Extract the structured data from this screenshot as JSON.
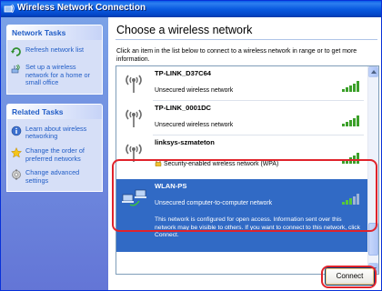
{
  "window": {
    "title": "Wireless Network Connection"
  },
  "sidebar": {
    "groups": [
      {
        "header": "Network Tasks",
        "items": [
          {
            "label": "Refresh network list",
            "icon": "refresh-icon"
          },
          {
            "label": "Set up a wireless network for a home or small office",
            "icon": "setup-network-icon"
          }
        ]
      },
      {
        "header": "Related Tasks",
        "items": [
          {
            "label": "Learn about wireless networking",
            "icon": "info-icon"
          },
          {
            "label": "Change the order of preferred networks",
            "icon": "star-icon"
          },
          {
            "label": "Change advanced settings",
            "icon": "settings-icon"
          }
        ]
      }
    ]
  },
  "main": {
    "title": "Choose a wireless network",
    "instruction": "Click an item in the list below to connect to a wireless network in range or to get more information.",
    "networks": [
      {
        "name": "TP-LINK_D37C64",
        "status": "Unsecured wireless network",
        "signal_bars": 5,
        "secured": false,
        "selected": false
      },
      {
        "name": "TP-LINK_0001DC",
        "status": "Unsecured wireless network",
        "signal_bars": 5,
        "secured": false,
        "selected": false
      },
      {
        "name": "linksys-szmateton",
        "status": "Security-enabled wireless network (WPA)",
        "signal_bars": 5,
        "secured": true,
        "selected": false
      },
      {
        "name": "WLAN-PS",
        "status": "Unsecured computer-to-computer network",
        "signal_bars": 3,
        "secured": false,
        "selected": true,
        "description": "This network is configured for open access. Information sent over this network may be visible to others. If you want to connect to this network, click Connect."
      }
    ],
    "connect_label": "Connect"
  },
  "colors": {
    "title_bar": "#0a5ae0",
    "selection": "#316ac5",
    "link": "#215dc6",
    "annotation": "#e0232b",
    "signal": "#3ca02a"
  }
}
